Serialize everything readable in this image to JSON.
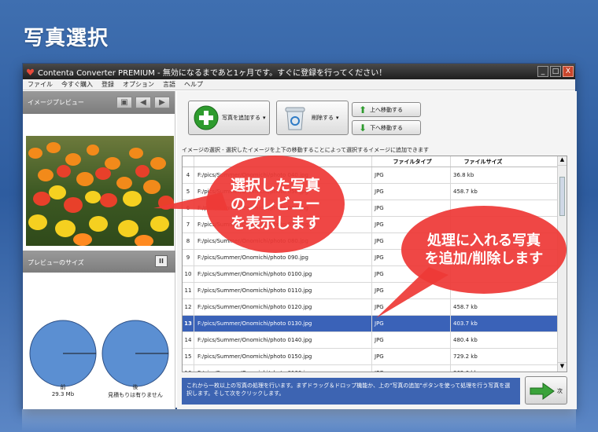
{
  "page_title": "写真選択",
  "window": {
    "title": "Contenta Converter PREMIUM - 無効になるまであと1ヶ月です。すぐに登録を行ってください！",
    "controls": [
      "_",
      "□",
      "X"
    ]
  },
  "menu": [
    "ファイル",
    "今すぐ購入",
    "登録",
    "オプション",
    "言語",
    "ヘルプ"
  ],
  "left_panel": {
    "preview_title": "イメージプレビュー",
    "size_title": "プレビューのサイズ",
    "pause_label": "II",
    "before_label": "前",
    "before_value": "29.3 Mb",
    "after_label": "後",
    "after_value": "見積もりは有りません"
  },
  "toolbar": {
    "add_label": "写真を追加する",
    "delete_label": "削除する",
    "up_label": "上へ移動する",
    "down_label": "下へ移動する",
    "arrow": "▾"
  },
  "hint_text": "イメージの選択 - 選択したイメージを上下の移動することによって選択するイメージに追加できます",
  "table": {
    "headers": [
      "",
      "",
      "ファイルタイプ",
      "ファイルサイズ"
    ],
    "rows": [
      {
        "n": "4",
        "path": "F:/pics/Summer/Onomichi/photo 040.jpg",
        "type": "JPG",
        "size": "36.8 kb"
      },
      {
        "n": "5",
        "path": "F:/pics/Summer/Onomichi/photo 050.jpg",
        "type": "JPG",
        "size": "458.7 kb"
      },
      {
        "n": "6",
        "path": "F:/pics/Summer/Onomichi/photo 060.jpg",
        "type": "JPG",
        "size": ""
      },
      {
        "n": "7",
        "path": "F:/pics/Summer/Onomichi/photo 070.jpg",
        "type": "JPG",
        "size": ""
      },
      {
        "n": "8",
        "path": "F:/pics/Summer/Onomichi/photo 080.jpg",
        "type": "JPG",
        "size": ""
      },
      {
        "n": "9",
        "path": "F:/pics/Summer/Onomichi/photo 090.jpg",
        "type": "JPG",
        "size": ""
      },
      {
        "n": "10",
        "path": "F:/pics/Summer/Onomichi/photo 0100.jpg",
        "type": "JPG",
        "size": ""
      },
      {
        "n": "11",
        "path": "F:/pics/Summer/Onomichi/photo 0110.jpg",
        "type": "JPG",
        "size": ""
      },
      {
        "n": "12",
        "path": "F:/pics/Summer/Onomichi/photo 0120.jpg",
        "type": "JPG",
        "size": "458.7 kb"
      },
      {
        "n": "13",
        "path": "F:/pics/Summer/Onomichi/photo 0130.jpg",
        "type": "JPG",
        "size": "403.7 kb"
      },
      {
        "n": "14",
        "path": "F:/pics/Summer/Onomichi/photo 0140.jpg",
        "type": "JPG",
        "size": "480.4 kb"
      },
      {
        "n": "15",
        "path": "F:/pics/Summer/Onomichi/photo 0150.jpg",
        "type": "JPG",
        "size": "729.2 kb"
      },
      {
        "n": "16",
        "path": "F:/pics/Summer/Onomichi/photo 0160.jpg",
        "type": "JPG",
        "size": "362.6 kb"
      }
    ],
    "selected_index": 9
  },
  "info_text": "これから一枚以上の写真の処理を行います。まずドラッグ＆ドロップ機能か、上の\"写真の追加\"ボタンを使って処理を行う写真を選択します。そして次をクリックします。",
  "next_label": "次",
  "callouts": {
    "preview": "選択した写真のプレビューを表示します",
    "add": "処理に入れる写真を追加/削除します"
  },
  "colors": {
    "selected_row": "#3a62b8",
    "callout": "#ee3a37",
    "pie": "#5b8fd2"
  }
}
